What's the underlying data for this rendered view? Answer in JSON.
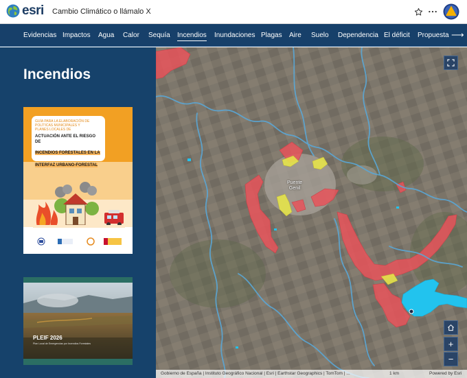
{
  "header": {
    "logo_text": "esri",
    "story_title": "Cambio Climático o llámalo X"
  },
  "nav": {
    "items": [
      "Evidencias",
      "Impactos",
      "Agua",
      "Calor",
      "Sequía",
      "Incendios",
      "Inundaciones",
      "Plagas",
      "Aire",
      "Suelo",
      "Dependencia",
      "El déficit",
      "Propuesta"
    ],
    "active": "Incendios",
    "next_arrow": "⟶"
  },
  "section": {
    "title": "Incendios"
  },
  "card_guide": {
    "line1": "GUÍA PARA LA ELABORACIÓN DE",
    "line2": "POLÍTICAS MUNICIPALES Y",
    "line3": "PLANES LOCALES DE",
    "line4": "ACTUACIÓN ANTE EL RIESGO DE",
    "line5": "INCENDIOS FORESTALES EN LA",
    "line6": "INTERFAZ URBANO-FORESTAL"
  },
  "card_plan": {
    "title": "PLEIF 2026",
    "subtitle": "Plan Local de Emergencias por Incendios Forestales"
  },
  "map": {
    "town_label_1": "Puente",
    "town_label_2": "Genil",
    "attribution": "Gobierno de España | Instituto Geográfico Nacional | Esri | Earthstar Geographics | TomTom | ...",
    "scale": "1 km",
    "powered_by": "Powered by Esri",
    "zoom_in": "+",
    "zoom_out": "−"
  },
  "colors": {
    "nav_bg": "#17406a",
    "panel_bg": "#16426b",
    "fire_risk": "#e8545a",
    "fire_interface": "#e5e34a",
    "reservoir": "#22c3ee",
    "river": "#5aa7d6"
  },
  "icons": [
    "globe-icon",
    "star-icon",
    "more-icon",
    "warning-badge-icon",
    "expand-icon",
    "home-icon"
  ]
}
